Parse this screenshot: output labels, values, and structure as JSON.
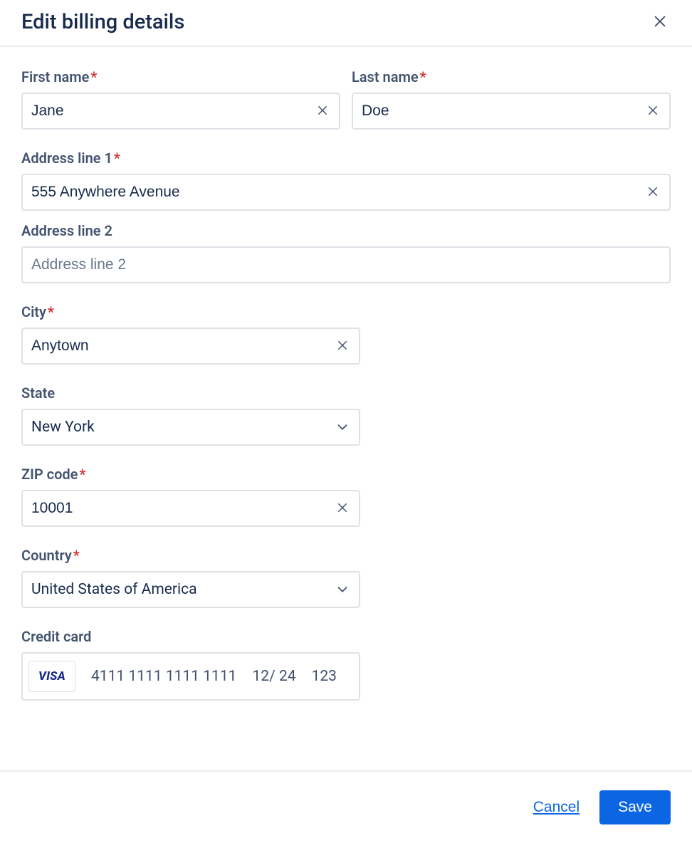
{
  "header": {
    "title": "Edit billing details"
  },
  "fields": {
    "first_name": {
      "label": "First name",
      "value": "Jane",
      "required": true
    },
    "last_name": {
      "label": "Last name",
      "value": "Doe",
      "required": true
    },
    "address1": {
      "label": "Address line 1",
      "value": "555 Anywhere Avenue",
      "required": true
    },
    "address2": {
      "label": "Address line 2",
      "value": "",
      "placeholder": "Address line 2",
      "required": false
    },
    "city": {
      "label": "City",
      "value": "Anytown",
      "required": true
    },
    "state": {
      "label": "State",
      "value": "New York",
      "required": false
    },
    "zip": {
      "label": "ZIP code",
      "value": "10001",
      "required": true
    },
    "country": {
      "label": "Country",
      "value": "United States of America",
      "required": true
    },
    "credit_card": {
      "label": "Credit card",
      "brand": "VISA",
      "number": "4111 1111 1111 1111",
      "expiry": "12/ 24",
      "cvc": "123"
    }
  },
  "footer": {
    "cancel": "Cancel",
    "save": "Save"
  },
  "required_marker": "*"
}
